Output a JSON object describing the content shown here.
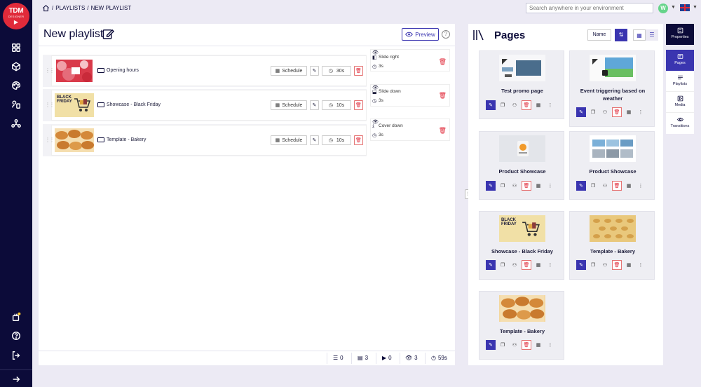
{
  "brand": {
    "line1": "TDM",
    "line2": "DESIGNER",
    "play": "▶"
  },
  "sidebar_icons": [
    "dashboard-icon",
    "cube-icon",
    "palette-icon",
    "devices-icon",
    "network-icon",
    "plugin-icon",
    "help-icon",
    "logout-icon",
    "expand-arrow-icon"
  ],
  "breadcrumb": {
    "sep": "/",
    "parent": "PLAYLISTS",
    "current": "NEW PLAYLIST"
  },
  "search": {
    "placeholder": "Search anywhere in your environment"
  },
  "user": {
    "initial": "W"
  },
  "editor": {
    "title": "New playlist",
    "preview_label": "Preview",
    "help": "?",
    "schedule_label": "Schedule",
    "items": [
      {
        "name": "Opening hours",
        "duration": "30s",
        "badge": ""
      },
      {
        "name": "Showcase - Black Friday",
        "duration": "10s",
        "badge": "BLACK FRIDAY"
      },
      {
        "name": "Template - Bakery",
        "duration": "10s",
        "badge": ""
      }
    ],
    "transitions": [
      {
        "name": "Slide right",
        "duration": "3s"
      },
      {
        "name": "Slide down",
        "duration": "3s"
      },
      {
        "name": "Cover down",
        "duration": "3s"
      }
    ],
    "footer": {
      "layouts": "0",
      "pages": "3",
      "media": "0",
      "transitions": "3",
      "total": "59s"
    }
  },
  "pages_panel": {
    "title": "Pages",
    "sort_label": "Name",
    "cards": [
      {
        "title": "Test promo page"
      },
      {
        "title": "Event triggering based on weather"
      },
      {
        "title": "Product Showcase"
      },
      {
        "title": "Product Showcase"
      },
      {
        "title": "Showcase - Black Friday",
        "badge": "BLACK FRIDAY"
      },
      {
        "title": "Template - Bakery"
      },
      {
        "title": "Template - Bakery"
      }
    ]
  },
  "right_nav": [
    {
      "label": "Properties"
    },
    {
      "label": "Pages"
    },
    {
      "label": "Playlists"
    },
    {
      "label": "Media"
    },
    {
      "label": "Transitions"
    }
  ],
  "colors": {
    "sidebar": "#0c0b39",
    "accent": "#3a35b0",
    "danger": "#e02a3a",
    "background": "#eceaf4"
  }
}
